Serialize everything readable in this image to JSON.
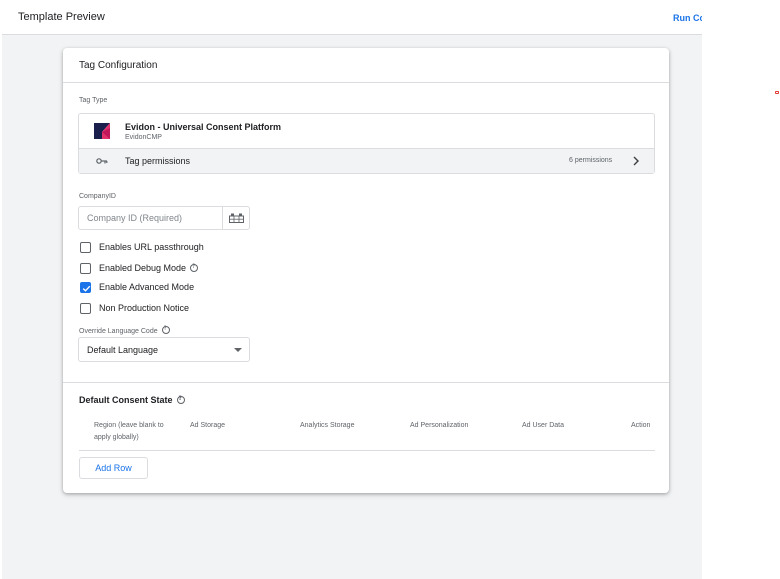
{
  "header": {
    "title": "Template Preview",
    "run_label": "Run Co"
  },
  "card": {
    "title": "Tag Configuration",
    "tag_type": {
      "label": "Tag Type",
      "name": "Evidon - Universal Consent Platform",
      "sub": "EvidonCMP",
      "permissions_label": "Tag permissions",
      "permissions_count": "6 permissions"
    },
    "company": {
      "label": "CompanyID",
      "placeholder": "Company ID (Required)",
      "value": ""
    },
    "checkboxes": [
      {
        "label": "Enables URL passthrough",
        "checked": false
      },
      {
        "label": "Enabled Debug Mode",
        "checked": false
      },
      {
        "label": "Enable Advanced Mode",
        "checked": true
      },
      {
        "label": "Non Production Notice",
        "checked": false
      }
    ],
    "language": {
      "label": "Override Language Code",
      "selected": "Default Language"
    },
    "consent": {
      "title": "Default Consent State",
      "columns": [
        "Region (leave blank to apply globally)",
        "Ad Storage",
        "Analytics Storage",
        "Ad Personalization",
        "Ad User Data",
        "Action"
      ],
      "add_row_label": "Add Row"
    }
  },
  "colors": {
    "accent": "#1a73e8",
    "logo_dark": "#1b1f4b",
    "logo_pink": "#e0316b"
  }
}
